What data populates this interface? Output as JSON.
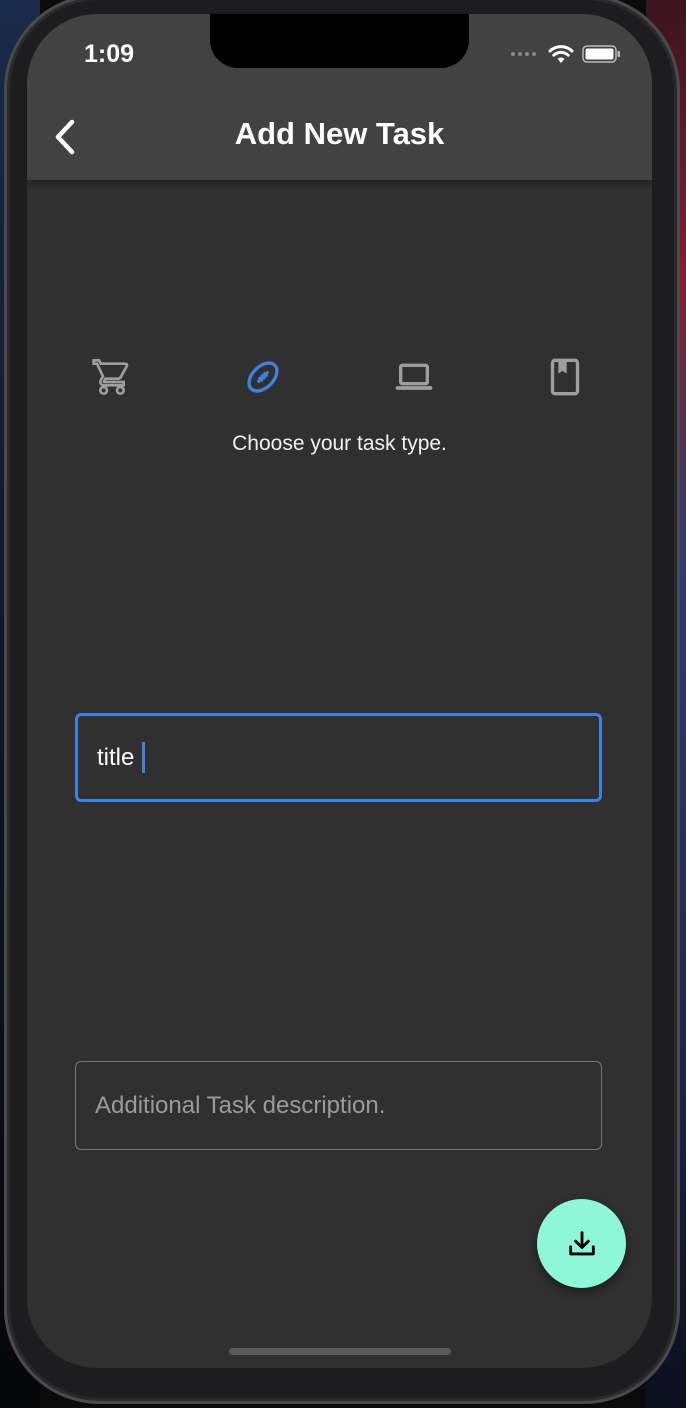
{
  "status_bar": {
    "time": "1:09",
    "icons": [
      "cellular-dots-icon",
      "wifi-icon",
      "battery-icon"
    ]
  },
  "app_bar": {
    "title": "Add New Task",
    "back_icon": "chevron-left-icon"
  },
  "task_types": {
    "items": [
      {
        "icon": "shopping-cart-icon",
        "selected": false
      },
      {
        "icon": "football-icon",
        "selected": true
      },
      {
        "icon": "laptop-icon",
        "selected": false
      },
      {
        "icon": "book-icon",
        "selected": false
      }
    ],
    "hint": "Choose your task type."
  },
  "form": {
    "title_value": "title",
    "description_placeholder": "Additional Task description."
  },
  "fab": {
    "icon": "download-icon"
  },
  "colors": {
    "background": "#303030",
    "app_bar": "#424242",
    "accent": "#3b82e3",
    "fab": "#8ef7d8",
    "icon_inactive": "#9e9e9e"
  }
}
